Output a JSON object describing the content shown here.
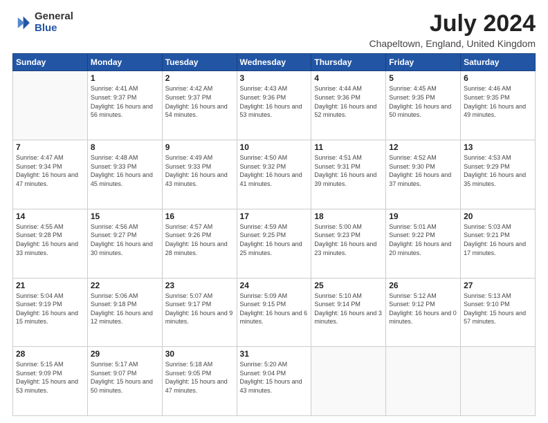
{
  "logo": {
    "general": "General",
    "blue": "Blue",
    "icon": "▶"
  },
  "title": "July 2024",
  "subtitle": "Chapeltown, England, United Kingdom",
  "days_header": [
    "Sunday",
    "Monday",
    "Tuesday",
    "Wednesday",
    "Thursday",
    "Friday",
    "Saturday"
  ],
  "weeks": [
    [
      {
        "day": "",
        "sunrise": "",
        "sunset": "",
        "daylight": ""
      },
      {
        "day": "1",
        "sunrise": "Sunrise: 4:41 AM",
        "sunset": "Sunset: 9:37 PM",
        "daylight": "Daylight: 16 hours and 56 minutes."
      },
      {
        "day": "2",
        "sunrise": "Sunrise: 4:42 AM",
        "sunset": "Sunset: 9:37 PM",
        "daylight": "Daylight: 16 hours and 54 minutes."
      },
      {
        "day": "3",
        "sunrise": "Sunrise: 4:43 AM",
        "sunset": "Sunset: 9:36 PM",
        "daylight": "Daylight: 16 hours and 53 minutes."
      },
      {
        "day": "4",
        "sunrise": "Sunrise: 4:44 AM",
        "sunset": "Sunset: 9:36 PM",
        "daylight": "Daylight: 16 hours and 52 minutes."
      },
      {
        "day": "5",
        "sunrise": "Sunrise: 4:45 AM",
        "sunset": "Sunset: 9:35 PM",
        "daylight": "Daylight: 16 hours and 50 minutes."
      },
      {
        "day": "6",
        "sunrise": "Sunrise: 4:46 AM",
        "sunset": "Sunset: 9:35 PM",
        "daylight": "Daylight: 16 hours and 49 minutes."
      }
    ],
    [
      {
        "day": "7",
        "sunrise": "Sunrise: 4:47 AM",
        "sunset": "Sunset: 9:34 PM",
        "daylight": "Daylight: 16 hours and 47 minutes."
      },
      {
        "day": "8",
        "sunrise": "Sunrise: 4:48 AM",
        "sunset": "Sunset: 9:33 PM",
        "daylight": "Daylight: 16 hours and 45 minutes."
      },
      {
        "day": "9",
        "sunrise": "Sunrise: 4:49 AM",
        "sunset": "Sunset: 9:33 PM",
        "daylight": "Daylight: 16 hours and 43 minutes."
      },
      {
        "day": "10",
        "sunrise": "Sunrise: 4:50 AM",
        "sunset": "Sunset: 9:32 PM",
        "daylight": "Daylight: 16 hours and 41 minutes."
      },
      {
        "day": "11",
        "sunrise": "Sunrise: 4:51 AM",
        "sunset": "Sunset: 9:31 PM",
        "daylight": "Daylight: 16 hours and 39 minutes."
      },
      {
        "day": "12",
        "sunrise": "Sunrise: 4:52 AM",
        "sunset": "Sunset: 9:30 PM",
        "daylight": "Daylight: 16 hours and 37 minutes."
      },
      {
        "day": "13",
        "sunrise": "Sunrise: 4:53 AM",
        "sunset": "Sunset: 9:29 PM",
        "daylight": "Daylight: 16 hours and 35 minutes."
      }
    ],
    [
      {
        "day": "14",
        "sunrise": "Sunrise: 4:55 AM",
        "sunset": "Sunset: 9:28 PM",
        "daylight": "Daylight: 16 hours and 33 minutes."
      },
      {
        "day": "15",
        "sunrise": "Sunrise: 4:56 AM",
        "sunset": "Sunset: 9:27 PM",
        "daylight": "Daylight: 16 hours and 30 minutes."
      },
      {
        "day": "16",
        "sunrise": "Sunrise: 4:57 AM",
        "sunset": "Sunset: 9:26 PM",
        "daylight": "Daylight: 16 hours and 28 minutes."
      },
      {
        "day": "17",
        "sunrise": "Sunrise: 4:59 AM",
        "sunset": "Sunset: 9:25 PM",
        "daylight": "Daylight: 16 hours and 25 minutes."
      },
      {
        "day": "18",
        "sunrise": "Sunrise: 5:00 AM",
        "sunset": "Sunset: 9:23 PM",
        "daylight": "Daylight: 16 hours and 23 minutes."
      },
      {
        "day": "19",
        "sunrise": "Sunrise: 5:01 AM",
        "sunset": "Sunset: 9:22 PM",
        "daylight": "Daylight: 16 hours and 20 minutes."
      },
      {
        "day": "20",
        "sunrise": "Sunrise: 5:03 AM",
        "sunset": "Sunset: 9:21 PM",
        "daylight": "Daylight: 16 hours and 17 minutes."
      }
    ],
    [
      {
        "day": "21",
        "sunrise": "Sunrise: 5:04 AM",
        "sunset": "Sunset: 9:19 PM",
        "daylight": "Daylight: 16 hours and 15 minutes."
      },
      {
        "day": "22",
        "sunrise": "Sunrise: 5:06 AM",
        "sunset": "Sunset: 9:18 PM",
        "daylight": "Daylight: 16 hours and 12 minutes."
      },
      {
        "day": "23",
        "sunrise": "Sunrise: 5:07 AM",
        "sunset": "Sunset: 9:17 PM",
        "daylight": "Daylight: 16 hours and 9 minutes."
      },
      {
        "day": "24",
        "sunrise": "Sunrise: 5:09 AM",
        "sunset": "Sunset: 9:15 PM",
        "daylight": "Daylight: 16 hours and 6 minutes."
      },
      {
        "day": "25",
        "sunrise": "Sunrise: 5:10 AM",
        "sunset": "Sunset: 9:14 PM",
        "daylight": "Daylight: 16 hours and 3 minutes."
      },
      {
        "day": "26",
        "sunrise": "Sunrise: 5:12 AM",
        "sunset": "Sunset: 9:12 PM",
        "daylight": "Daylight: 16 hours and 0 minutes."
      },
      {
        "day": "27",
        "sunrise": "Sunrise: 5:13 AM",
        "sunset": "Sunset: 9:10 PM",
        "daylight": "Daylight: 15 hours and 57 minutes."
      }
    ],
    [
      {
        "day": "28",
        "sunrise": "Sunrise: 5:15 AM",
        "sunset": "Sunset: 9:09 PM",
        "daylight": "Daylight: 15 hours and 53 minutes."
      },
      {
        "day": "29",
        "sunrise": "Sunrise: 5:17 AM",
        "sunset": "Sunset: 9:07 PM",
        "daylight": "Daylight: 15 hours and 50 minutes."
      },
      {
        "day": "30",
        "sunrise": "Sunrise: 5:18 AM",
        "sunset": "Sunset: 9:05 PM",
        "daylight": "Daylight: 15 hours and 47 minutes."
      },
      {
        "day": "31",
        "sunrise": "Sunrise: 5:20 AM",
        "sunset": "Sunset: 9:04 PM",
        "daylight": "Daylight: 15 hours and 43 minutes."
      },
      {
        "day": "",
        "sunrise": "",
        "sunset": "",
        "daylight": ""
      },
      {
        "day": "",
        "sunrise": "",
        "sunset": "",
        "daylight": ""
      },
      {
        "day": "",
        "sunrise": "",
        "sunset": "",
        "daylight": ""
      }
    ]
  ]
}
